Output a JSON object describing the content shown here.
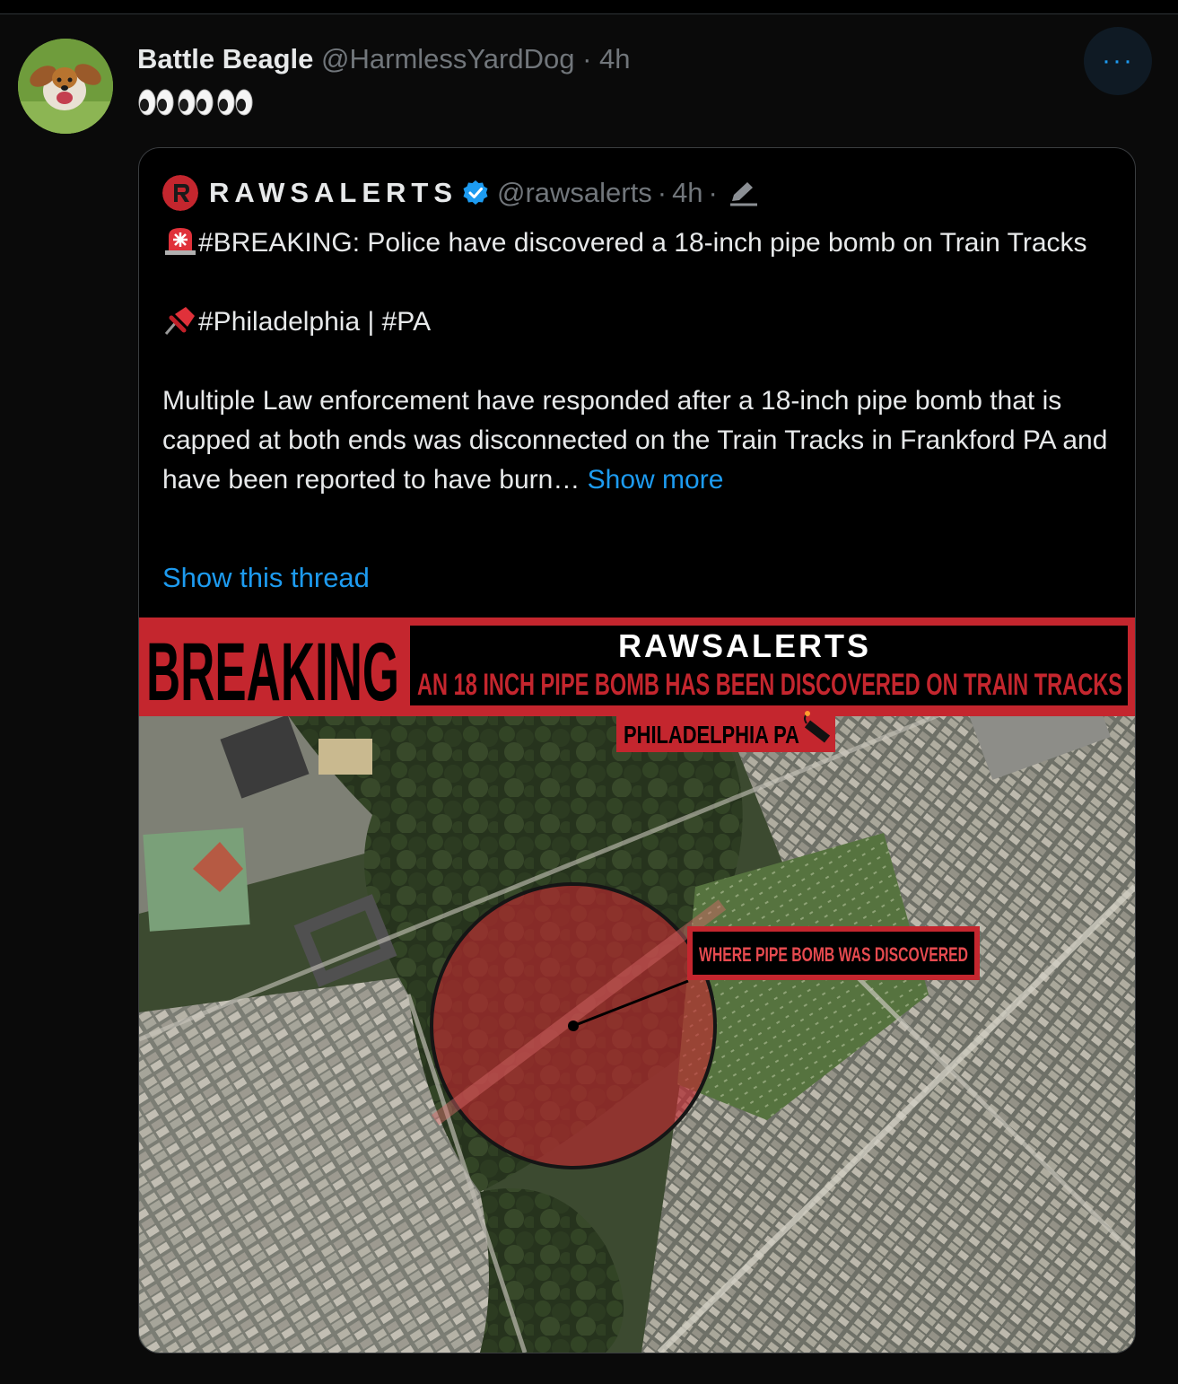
{
  "tweet": {
    "display_name": "Battle Beagle",
    "handle": "@HarmlessYardDog",
    "time": "4h",
    "separator": "·",
    "body_emoji": [
      "eyes-emoji",
      "eyes-emoji",
      "eyes-emoji"
    ],
    "more_label": "···"
  },
  "quote": {
    "name": "RAWSALERTS",
    "handle": "@rawsalerts",
    "time": "4h",
    "separator": "·",
    "line1": "#BREAKING: Police have discovered a 18-inch pipe bomb on Train Tracks",
    "line2": "#Philadelphia | #PA",
    "line3": "Multiple Law enforcement have responded after a 18-inch pipe bomb that is capped at both ends was disconnected on the Train Tracks in Frankford PA and have been reported to have burn…",
    "show_more": "Show more",
    "show_thread": "Show this thread",
    "image": {
      "banner_left": "BREAKING",
      "brand": "RAWSALERTS",
      "headline": "AN 18 INCH PIPE BOMB HAS BEEN DISCOVERED ON TRAIN TRACKS",
      "location": "PHILADELPHIA PA",
      "callout": "WHERE PIPE BOMB WAS DISCOVERED"
    }
  },
  "colors": {
    "background": "#0a0a0a",
    "text": "#e7e9ea",
    "muted": "#71767b",
    "link": "#1d9bf0",
    "alert_red": "#c4262e",
    "verified": "#1d9bf0"
  }
}
